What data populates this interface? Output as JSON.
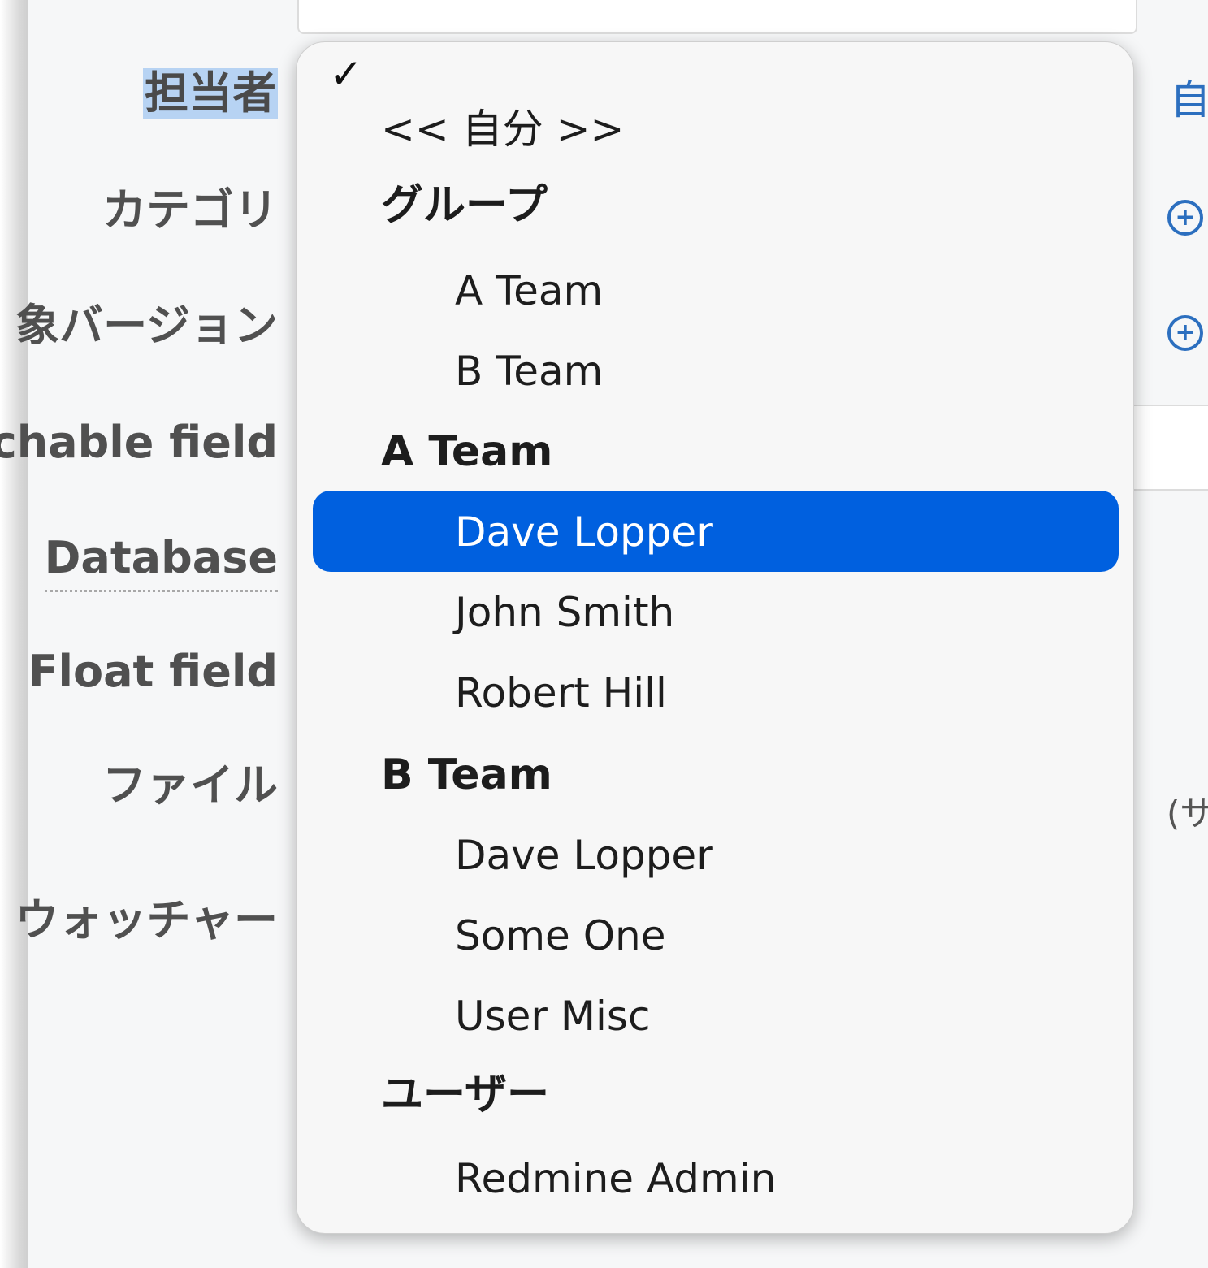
{
  "form": {
    "labels": {
      "assignee": "担当者",
      "category": "カテゴリ",
      "version": "象バージョン",
      "searchable": "chable field",
      "database": "Database",
      "float": "Float field",
      "file": "ファイル",
      "watcher": "ウォッチャー"
    },
    "right": {
      "assign_me": "自",
      "paren": "(サ"
    }
  },
  "dropdown": {
    "selected_index": 0,
    "highlighted": "Dave Lopper",
    "options": {
      "blank": "",
      "me": "<< 自分 >>",
      "group_groups": "グループ",
      "groups_a": "A Team",
      "groups_b": "B Team",
      "group_a": "A Team",
      "a_dave": "Dave Lopper",
      "a_john": "John Smith",
      "a_robert": "Robert Hill",
      "group_b": "B Team",
      "b_dave": "Dave Lopper",
      "b_some": "Some One",
      "b_misc": "User Misc",
      "group_users": "ユーザー",
      "u_admin": "Redmine Admin"
    }
  },
  "colors": {
    "highlight": "#0060df",
    "label_selection": "#b7d3f3",
    "link": "#2c6fbf"
  }
}
